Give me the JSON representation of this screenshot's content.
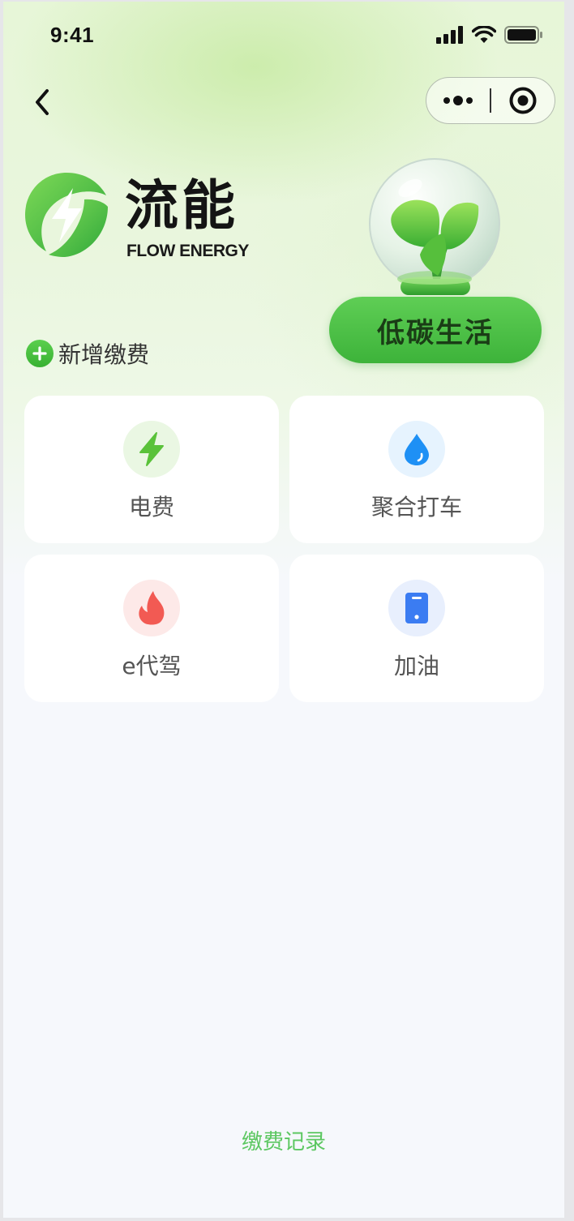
{
  "status_bar": {
    "time": "9:41"
  },
  "nav": {
    "back_icon": "chevron-left-icon",
    "capsule_more_icon": "more-dots-icon",
    "capsule_close_icon": "target-circle-icon"
  },
  "brand": {
    "name_cn": "流能",
    "name_en": "FLOW ENERGY",
    "logo_icon": "lightning-leaf-logo",
    "brand_color": "#46b944"
  },
  "hero": {
    "globe_icon": "leaf-glass-globe",
    "low_carbon_label": "低碳生活"
  },
  "add_bill": {
    "label": "新增缴费",
    "icon": "plus-circle-icon"
  },
  "services": [
    {
      "label": "电费",
      "icon": "lightning-icon",
      "icon_color": "#5ac23a",
      "icon_bg": "#eaf7e3"
    },
    {
      "label": "聚合打车",
      "icon": "water-drop-icon",
      "icon_color": "#1e90f5",
      "icon_bg": "#e6f3fe"
    },
    {
      "label": "e代驾",
      "icon": "flame-icon",
      "icon_color": "#f25a53",
      "icon_bg": "#fde9e8"
    },
    {
      "label": "加油",
      "icon": "phone-icon",
      "icon_color": "#3b7cf2",
      "icon_bg": "#e8effd"
    }
  ],
  "footer": {
    "records_label": "缴费记录",
    "records_color": "#5cc761"
  }
}
